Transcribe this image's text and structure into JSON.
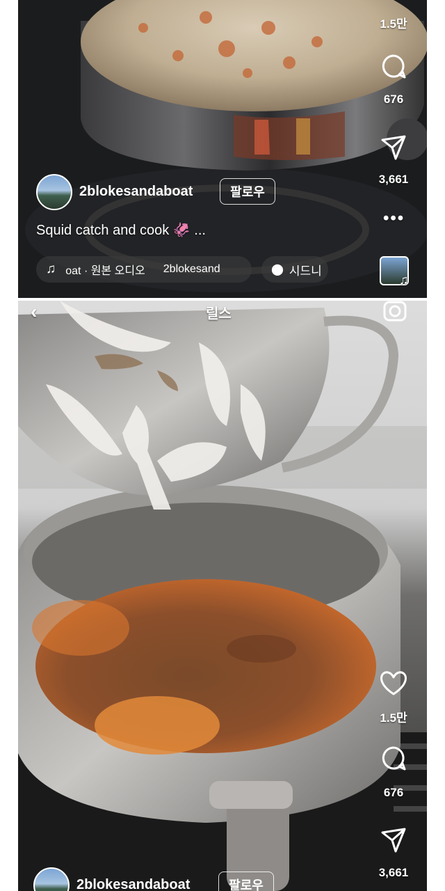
{
  "top_post": {
    "likes": "1.5만",
    "comments": "676",
    "shares": "3,661",
    "username": "2blokesandaboat",
    "follow_label": "팔로우",
    "caption": "Squid catch and cook 🦑 ...",
    "audio_label": "oat · 원본 오디오",
    "audio_user": "2blokesand",
    "location": "시드니"
  },
  "bottom_post": {
    "header_title": "릴스",
    "likes": "1.5만",
    "comments": "676",
    "shares": "3,661",
    "username": "2blokesandaboat",
    "follow_label": "팔로우"
  }
}
